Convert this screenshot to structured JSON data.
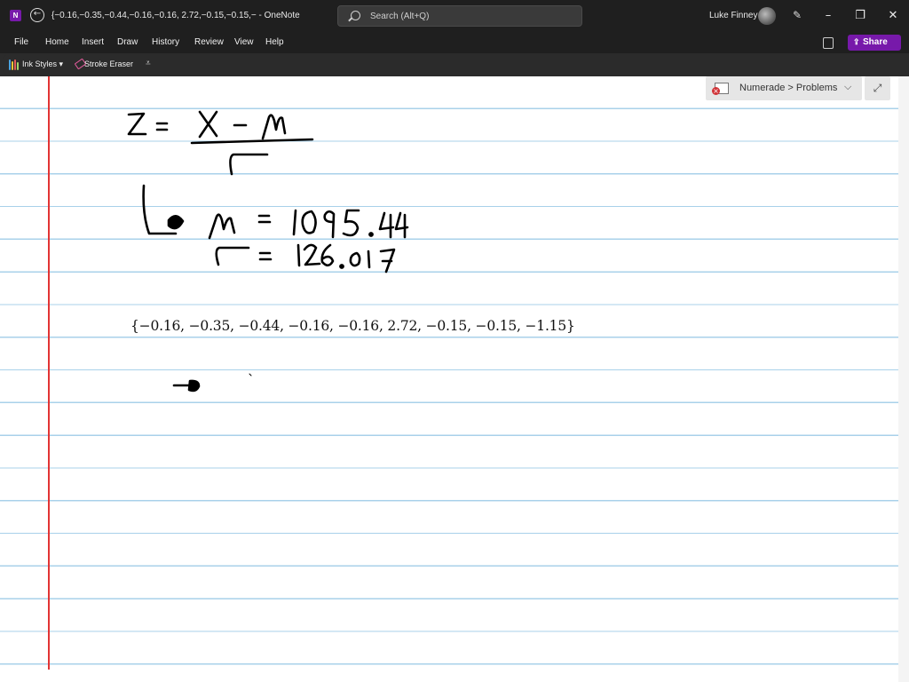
{
  "window": {
    "title": "{−0.16,−0.35,−0.44,−0.16,−0.16, 2.72,−0.15,−0.15,−  -  OneNote",
    "search_placeholder": "Search (Alt+Q)",
    "user_name": "Luke Finney",
    "app_icon_letter": "N"
  },
  "menu": {
    "items": [
      "File",
      "Home",
      "Insert",
      "Draw",
      "History",
      "Review",
      "View",
      "Help"
    ],
    "share_label": "Share"
  },
  "toolbar": {
    "ink_styles_label": "Ink Styles ▾",
    "stroke_eraser_label": "Stroke Eraser",
    "more_glyph": "⩡"
  },
  "sync_status": {
    "label": "Numerade > Problems"
  },
  "page": {
    "typed_set": "{−0.16, −0.35, −0.44, −0.16, −0.16, 2.72, −0.15, −0.15, −1.15}",
    "handwriting": {
      "formula": "Z = (X − μ) / σ",
      "mu_line": "μ = 1095.44",
      "sigma_line": "σ = 126.017"
    }
  },
  "colors": {
    "titlebar": "#1f1f1f",
    "accent": "#7719aa",
    "rule_line": "#a9d1ea",
    "margin_line": "#e23434"
  }
}
